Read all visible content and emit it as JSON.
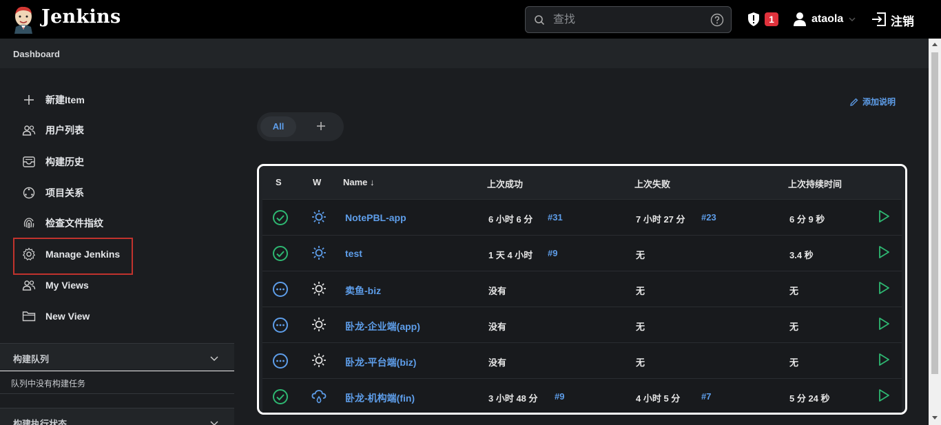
{
  "header": {
    "brand": "Jenkins",
    "search_placeholder": "查找",
    "notification_count": "1",
    "username": "ataola",
    "logout_label": "注销"
  },
  "breadcrumb": {
    "label": "Dashboard"
  },
  "sidebar": {
    "items": [
      {
        "label": "新建Item",
        "icon": "plus-icon"
      },
      {
        "label": "用户列表",
        "icon": "people-icon"
      },
      {
        "label": "构建历史",
        "icon": "inbox-icon"
      },
      {
        "label": "项目关系",
        "icon": "relationship-icon"
      },
      {
        "label": "检查文件指纹",
        "icon": "fingerprint-icon"
      },
      {
        "label": "Manage Jenkins",
        "icon": "gear-icon"
      },
      {
        "label": "My Views",
        "icon": "people-icon"
      },
      {
        "label": "New View",
        "icon": "folder-icon"
      }
    ],
    "queue_title": "构建队列",
    "queue_empty": "队列中没有构建任务",
    "executor_title": "构建执行状态"
  },
  "main": {
    "add_description": "添加说明",
    "tabs": {
      "all": "All"
    },
    "table": {
      "headers": {
        "s": "S",
        "w": "W",
        "name": "Name ↓",
        "last_success": "上次成功",
        "last_failure": "上次失败",
        "last_duration": "上次持续时间"
      },
      "rows": [
        {
          "status": "success",
          "weather": "sunny",
          "name": "NotePBL-app",
          "last_success": "6 小时 6 分",
          "success_build": "#31",
          "last_failure": "7 小时 27 分",
          "failure_build": "#23",
          "duration": "6 分 9 秒"
        },
        {
          "status": "success",
          "weather": "sunny",
          "name": "test",
          "last_success": "1 天 4 小时",
          "success_build": "#9",
          "last_failure": "无",
          "failure_build": "",
          "duration": "3.4 秒"
        },
        {
          "status": "notbuilt",
          "weather": "sunny-plain",
          "name": "卖鱼-biz",
          "last_success": "没有",
          "success_build": "",
          "last_failure": "无",
          "failure_build": "",
          "duration": "无"
        },
        {
          "status": "notbuilt",
          "weather": "sunny-plain",
          "name": "卧龙-企业端(app)",
          "last_success": "没有",
          "success_build": "",
          "last_failure": "无",
          "failure_build": "",
          "duration": "无"
        },
        {
          "status": "notbuilt",
          "weather": "sunny-plain",
          "name": "卧龙-平台端(biz)",
          "last_success": "没有",
          "success_build": "",
          "last_failure": "无",
          "failure_build": "",
          "duration": "无"
        },
        {
          "status": "success",
          "weather": "cloudy-rain",
          "name": "卧龙-机构端(fin)",
          "last_success": "3 小时 48 分",
          "success_build": "#9",
          "last_failure": "4 小时 5 分",
          "failure_build": "#7",
          "duration": "5 分 24 秒"
        }
      ]
    }
  },
  "colors": {
    "accent": "#5e9eea",
    "success": "#2eb872",
    "highlight_box": "#c2332d",
    "badge": "#e0323c"
  }
}
